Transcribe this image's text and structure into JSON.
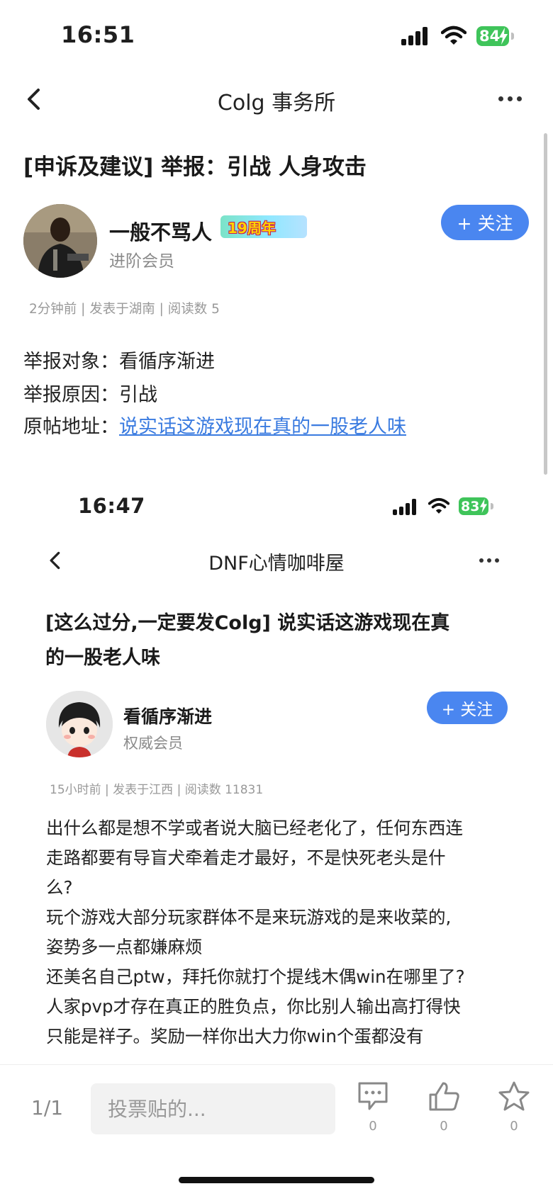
{
  "status_bar": {
    "time": "16:51",
    "battery": "84"
  },
  "nav": {
    "title": "Colg 事务所"
  },
  "post": {
    "title": "[申诉及建议] 举报：引战 人身攻击",
    "author": {
      "name": "一般不骂人",
      "level": "进阶会员",
      "badge": "19周年"
    },
    "follow_label": "+ 关注",
    "meta": "2分钟前 | 发表于湖南 | 阅读数 5",
    "report": {
      "target_label": "举报对象：",
      "target_value": "看循序渐进",
      "reason_label": "举报原因：",
      "reason_value": "引战",
      "link_label": "原帖地址：",
      "link_text": "说实话这游戏现在真的一股老人味"
    }
  },
  "embedded": {
    "status_bar": {
      "time": "16:47",
      "battery": "83"
    },
    "nav": {
      "title": "DNF心情咖啡屋"
    },
    "post": {
      "title_line1": "[这么过分,一定要发Colg] 说实话这游戏现在真",
      "title_line2": "的一股老人味",
      "author": {
        "name": "看循序渐进",
        "level": "权威会员"
      },
      "follow_label": "+ 关注",
      "meta": "15小时前 | 发表于江西 | 阅读数 11831",
      "body": [
        "出什么都是想不学或者说大脑已经老化了，任何东西连",
        "走路都要有导盲犬牵着走才最好，不是快死老头是什",
        "么?",
        "玩个游戏大部分玩家群体不是来玩游戏的是来收菜的,",
        "姿势多一点都嫌麻烦",
        "还美名自己ptw，拜托你就打个提线木偶win在哪里了?",
        "人家pvp才存在真正的胜负点，你比别人输出高打得快",
        "只能是祥子。奖励一样你出大力你win个蛋都没有"
      ]
    }
  },
  "bottom_bar": {
    "pager": "1/1",
    "vote_placeholder": "投票贴的...",
    "comment_count": "0",
    "like_count": "0",
    "favorite_count": "0"
  },
  "icons": [
    "back-icon",
    "more-icon",
    "signal-icon",
    "wifi-icon",
    "battery-icon",
    "comment-icon",
    "like-icon",
    "favorite-icon"
  ]
}
